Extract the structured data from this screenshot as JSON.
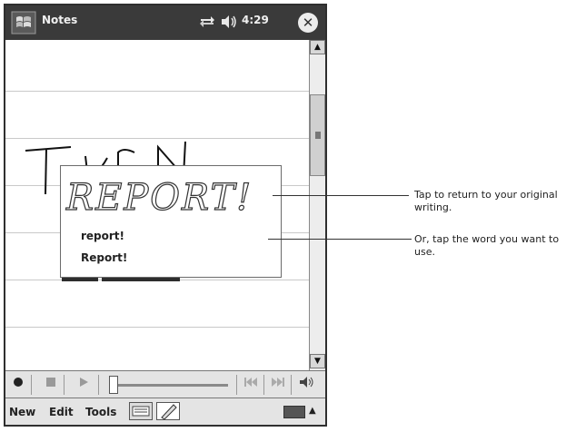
{
  "titlebar": {
    "app_title": "Notes",
    "clock": "4:29",
    "close_label": "✕",
    "start_icon": "windows-flag-icon",
    "sync_icon": "sync-icon",
    "speaker_icon": "speaker-icon"
  },
  "popup": {
    "handwriting": "REPORT!",
    "items": [
      "report!",
      "Report!"
    ]
  },
  "recorder": {
    "record_icon": "record-icon",
    "stop_icon": "stop-icon",
    "play_icon": "play-icon",
    "prev_icon": "skip-back-icon",
    "next_icon": "skip-forward-icon",
    "volume_icon": "volume-icon"
  },
  "command_bar": {
    "menu": [
      "New",
      "Edit",
      "Tools"
    ],
    "keyboard_icon": "keyboard-icon",
    "pen_icon": "pen-icon"
  },
  "callouts": {
    "first": "Tap to return to your original writing.",
    "second": "Or, tap the word you want to use."
  },
  "colors": {
    "titlebar": "#3a3a3a",
    "toolbar": "#e4e4e4",
    "ruled_line": "#c9c9c9"
  }
}
